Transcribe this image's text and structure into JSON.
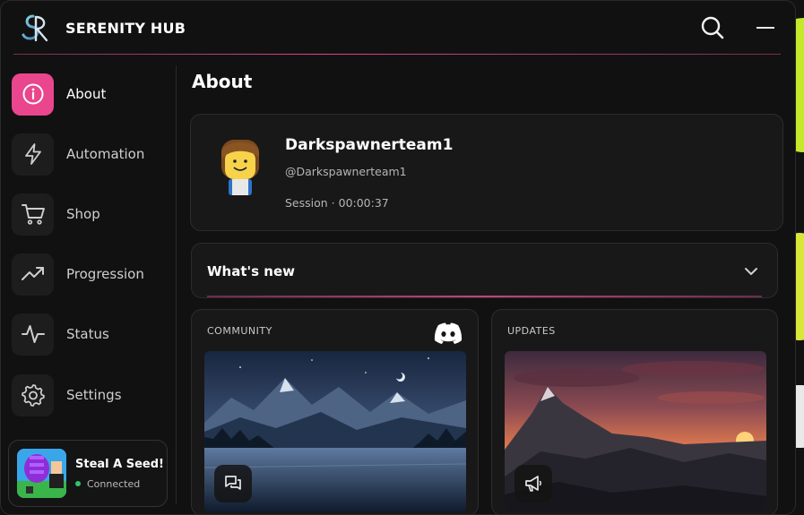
{
  "app": {
    "title": "SERENITY HUB",
    "logo_text": "SR"
  },
  "page": {
    "title": "About"
  },
  "sidebar": {
    "items": [
      {
        "label": "About",
        "icon": "info-icon",
        "active": true
      },
      {
        "label": "Automation",
        "icon": "lightning-icon",
        "active": false
      },
      {
        "label": "Shop",
        "icon": "cart-icon",
        "active": false
      },
      {
        "label": "Progression",
        "icon": "trending-up-icon",
        "active": false
      },
      {
        "label": "Status",
        "icon": "activity-icon",
        "active": false
      },
      {
        "label": "Settings",
        "icon": "gear-icon",
        "active": false
      }
    ],
    "game": {
      "name": "Steal A Seed!",
      "status": "Connected"
    }
  },
  "profile": {
    "display_name": "Darkspawnerteam1",
    "handle": "@Darkspawnerteam1",
    "session": "Session · 00:00:37"
  },
  "whats_new": {
    "label": "What's new"
  },
  "panels": {
    "community": {
      "tag": "COMMUNITY",
      "icon": "discord-icon"
    },
    "updates": {
      "tag": "UPDATES",
      "icon": "megaphone-icon"
    }
  },
  "colors": {
    "accent": "#e9468d",
    "status_ok": "#33c26e",
    "background": "#111111",
    "card": "#181818"
  }
}
